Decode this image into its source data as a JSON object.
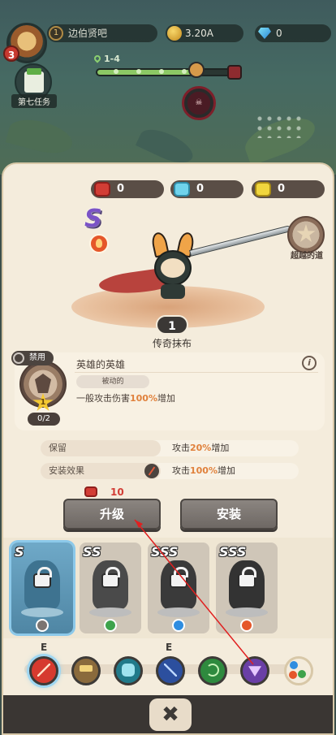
{
  "player": {
    "level": "3",
    "rank": "1",
    "name": "边伯贤吧"
  },
  "currency": {
    "gold": "3.20A",
    "gems": "0"
  },
  "quest": {
    "label": "第七任务"
  },
  "stage": {
    "label": "1-4"
  },
  "resources": {
    "red": "0",
    "blue": "0",
    "yellow": "0"
  },
  "hero": {
    "rank": "S",
    "level": "1",
    "name": "传奇抹布",
    "beyond_label": "超越的道"
  },
  "skill": {
    "ban_label": "禁用",
    "count": "0/2",
    "star_level": "1",
    "title": "英雄的英雄",
    "info": "i",
    "tag": "被动的",
    "desc_prefix": "一般攻击伤害",
    "desc_value": "100%",
    "desc_suffix": "增加"
  },
  "stats": [
    {
      "label": "保留",
      "value_prefix": "攻击",
      "value_num": "20%",
      "value_suffix": "增加"
    },
    {
      "label": "安装效果",
      "value_prefix": "攻击",
      "value_num": "100%",
      "value_suffix": "增加"
    }
  ],
  "upgrade": {
    "cost": "10",
    "upgrade_label": "升级",
    "install_label": "安装"
  },
  "roster": [
    {
      "grade": "S",
      "element": "neutral"
    },
    {
      "grade": "SS",
      "element": "lightning"
    },
    {
      "grade": "SSS",
      "element": "ice"
    },
    {
      "grade": "SSS",
      "element": "fire"
    }
  ],
  "tabs": {
    "e_labels": [
      "E",
      "E"
    ],
    "items": [
      "sword",
      "hammer",
      "gauntlet",
      "spear",
      "bow",
      "fan",
      "elements"
    ]
  },
  "close_label": "✖",
  "colors": {
    "accent": "#e0813c",
    "panel": "#f4ecdc",
    "button": "#7b7571",
    "red_stone": "#d23d35"
  }
}
